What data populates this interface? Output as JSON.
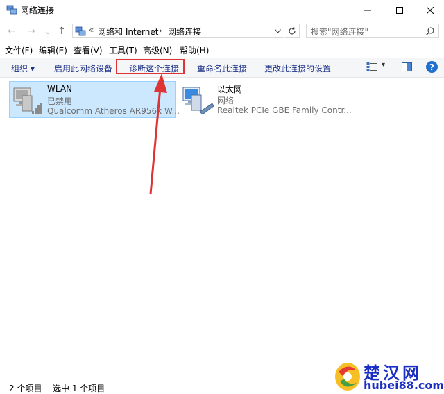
{
  "window": {
    "title": "网络连接",
    "minimize_glyph": "—",
    "maximize_glyph": "☐",
    "close_glyph": "✕"
  },
  "nav": {
    "back_glyph": "←",
    "forward_glyph": "→",
    "recent_glyph": "⌄",
    "up_glyph": "↑"
  },
  "address": {
    "prefix": "«",
    "crumbs": [
      "网络和 Internet",
      "网络连接"
    ],
    "separator": "›"
  },
  "search": {
    "placeholder": "搜索\"网络连接\""
  },
  "menu": [
    "文件(F)",
    "编辑(E)",
    "查看(V)",
    "工具(T)",
    "高级(N)",
    "帮助(H)"
  ],
  "commands": {
    "organize": "组织 ▾",
    "enable": "启用此网络设备",
    "diagnose": "诊断这个连接",
    "rename": "重命名此连接",
    "change_settings": "更改此连接的设置",
    "view_options_arrow": "▾",
    "help": "?"
  },
  "connections": [
    {
      "name": "WLAN",
      "status": "已禁用",
      "device": "Qualcomm Atheros AR956x W..."
    },
    {
      "name": "以太网",
      "status": "网络",
      "device": "Realtek PCIe GBE Family Contr..."
    }
  ],
  "status_bar": {
    "count": "2 个项目",
    "selected": "选中 1 个项目"
  },
  "watermark": {
    "logo_text": "楚汉网",
    "url": "hubei88.com"
  },
  "colors": {
    "accent": "#1e3287",
    "selection": "#cce8ff",
    "highlight": "#e03434",
    "help": "#1e6fd0"
  }
}
